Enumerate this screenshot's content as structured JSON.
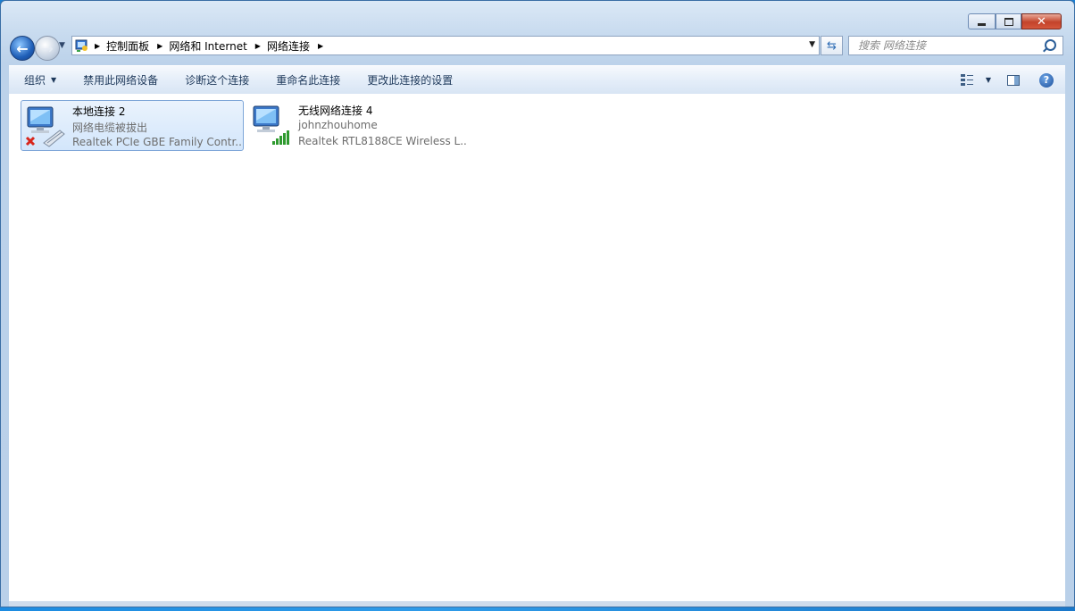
{
  "window": {
    "caption": {
      "minimize": "minimize",
      "maximize": "maximize",
      "close": "✕"
    }
  },
  "address_bar": {
    "crumbs": [
      "控制面板",
      "网络和 Internet",
      "网络连接"
    ]
  },
  "search": {
    "placeholder": "搜索 网络连接"
  },
  "toolbar": {
    "organize": "组织",
    "disable": "禁用此网络设备",
    "diagnose": "诊断这个连接",
    "rename": "重命名此连接",
    "change_settings": "更改此连接的设置"
  },
  "connections": [
    {
      "name": "本地连接 2",
      "status": "网络电缆被拔出",
      "device": "Realtek PCIe GBE Family Contr...",
      "selected": true
    },
    {
      "name": "无线网络连接 4",
      "status": "johnzhouhome",
      "device": "Realtek RTL8188CE Wireless L...",
      "selected": false
    }
  ],
  "colors": {
    "accent": "#1f5fb8",
    "selection_border": "#7ea6d8",
    "error_red": "#d8261c",
    "signal_green": "#2f9a2f"
  }
}
